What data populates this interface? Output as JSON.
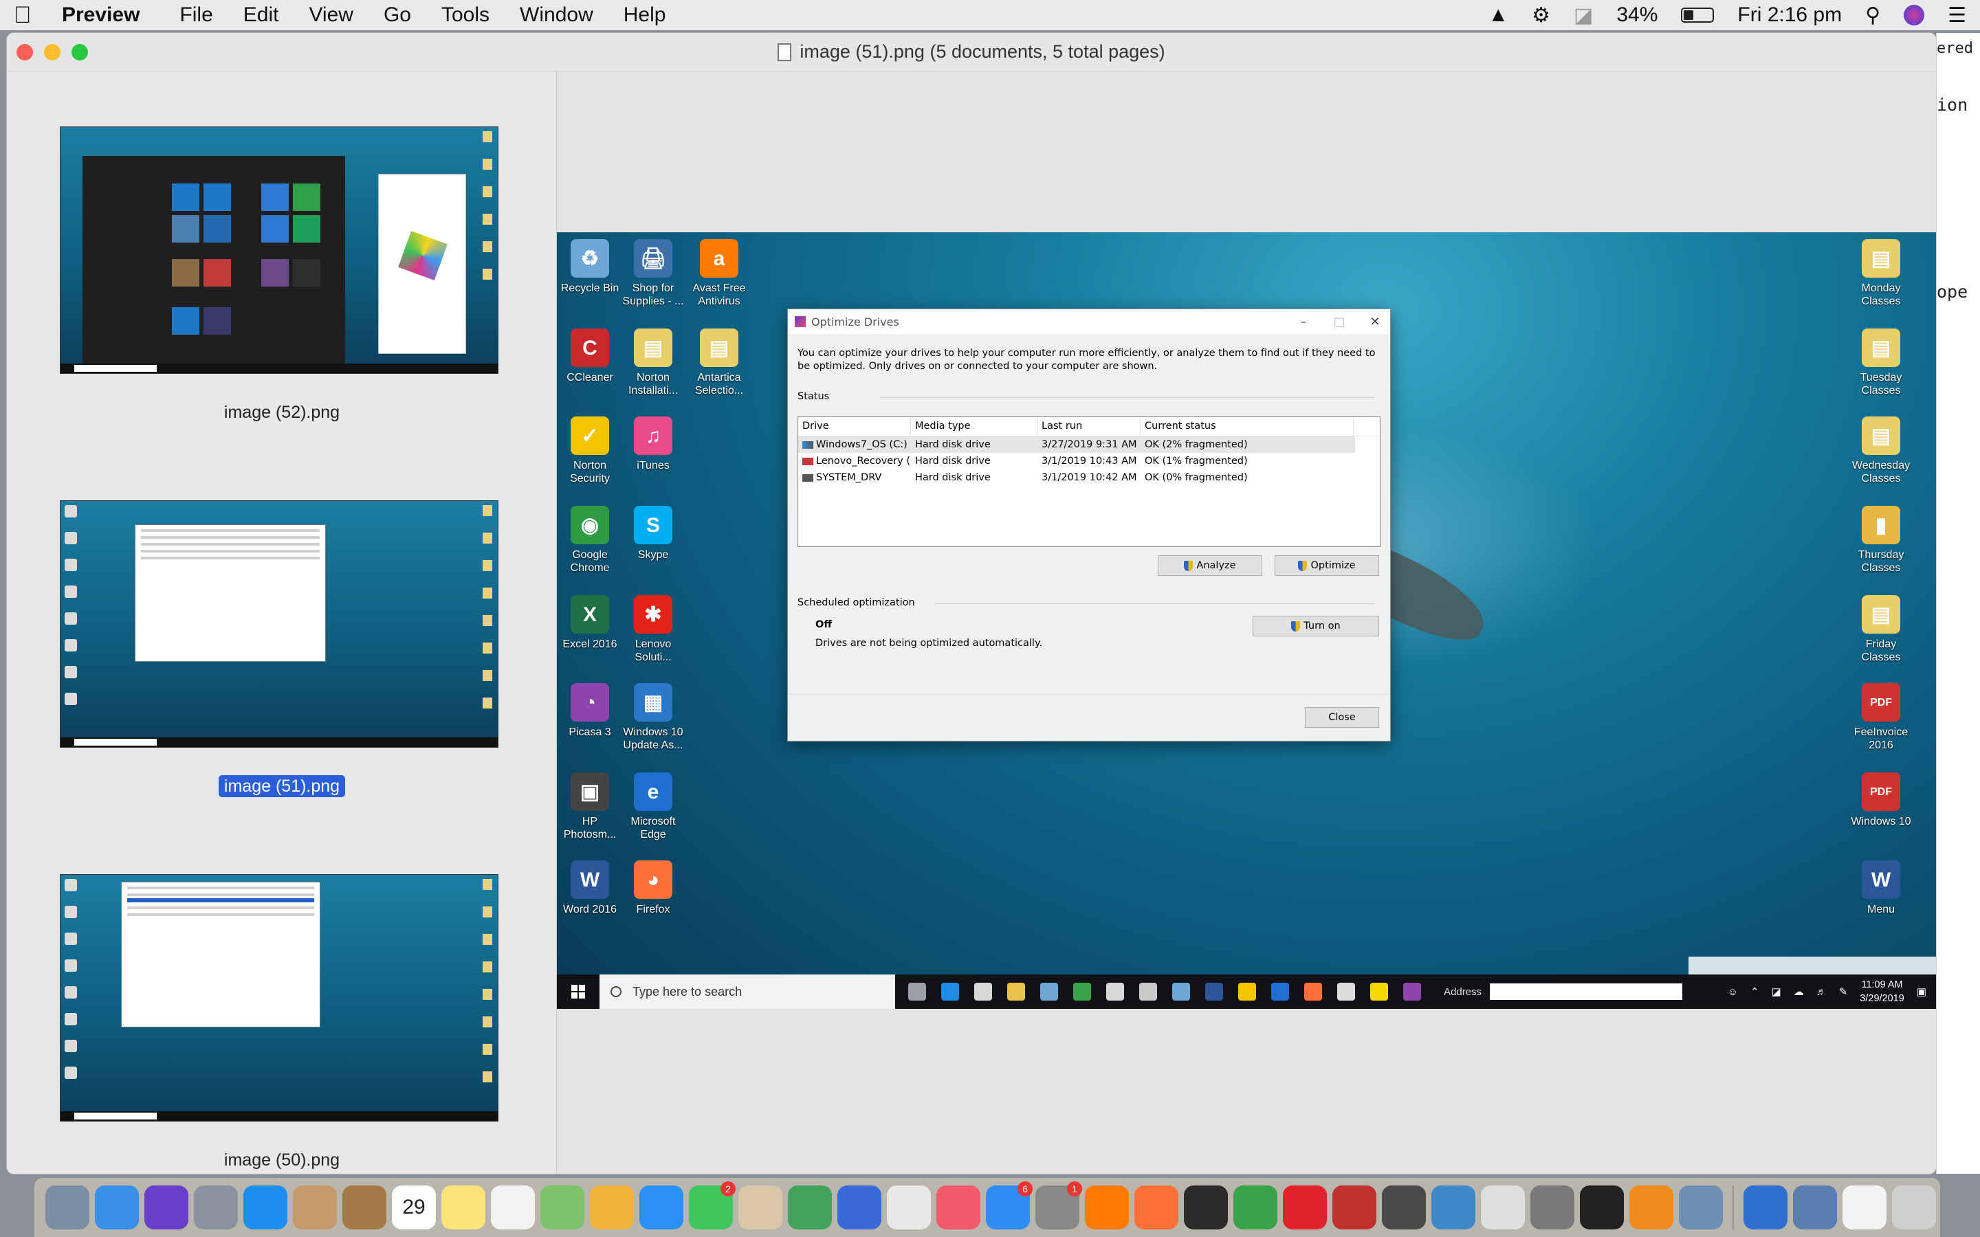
{
  "menubar": {
    "app": "Preview",
    "menus": [
      "File",
      "Edit",
      "View",
      "Go",
      "Tools",
      "Window",
      "Help"
    ],
    "battery": "34%",
    "battery_level": 0.34,
    "clock": "Fri 2:16 pm"
  },
  "window": {
    "title": "image (51).png (5 documents, 5 total pages)"
  },
  "sidebar": {
    "items": [
      {
        "label": "image (52).png",
        "selected": false
      },
      {
        "label": "image (51).png",
        "selected": true
      },
      {
        "label": "image (50).png",
        "selected": false
      }
    ]
  },
  "desktop": {
    "left_icons": [
      {
        "label": "Recycle Bin",
        "color": "#6fa6d8",
        "glyph": "♻"
      },
      {
        "label": "Shop for Supplies - ...",
        "color": "#3d6fa8",
        "glyph": "🖨"
      },
      {
        "label": "Avast Free Antivirus",
        "color": "#ff7a00",
        "glyph": "a"
      },
      {
        "label": "CCleaner",
        "color": "#c9282d",
        "glyph": "C"
      },
      {
        "label": "Norton Installati...",
        "color": "#e8cf6a",
        "glyph": "▤"
      },
      {
        "label": "Antartica Selectio...",
        "color": "#e8cf6a",
        "glyph": "▤"
      },
      {
        "label": "Norton Security",
        "color": "#f5c400",
        "glyph": "✓"
      },
      {
        "label": "iTunes",
        "color": "#ea4c89",
        "glyph": "♫"
      },
      {
        "label": "Google Chrome",
        "color": "#2f9a44",
        "glyph": "◉"
      },
      {
        "label": "Skype",
        "color": "#00aff0",
        "glyph": "S"
      },
      {
        "label": "Excel 2016",
        "color": "#1e7145",
        "glyph": "X"
      },
      {
        "label": "Lenovo Soluti...",
        "color": "#e2231a",
        "glyph": "✱"
      },
      {
        "label": "Picasa 3",
        "color": "#8e44ad",
        "glyph": "◔"
      },
      {
        "label": "Windows 10 Update As...",
        "color": "#2b78c8",
        "glyph": "▦"
      },
      {
        "label": "HP Photosm...",
        "color": "#444444",
        "glyph": "▣"
      },
      {
        "label": "Microsoft Edge",
        "color": "#1f6fd1",
        "glyph": "e"
      },
      {
        "label": "Word 2016",
        "color": "#2b579a",
        "glyph": "W"
      },
      {
        "label": "Firefox",
        "color": "#ff7139",
        "glyph": "◕"
      }
    ],
    "right_icons": [
      {
        "label": "Monday Classes",
        "color": "#e8cf6a",
        "glyph": "▤"
      },
      {
        "label": "Tuesday Classes",
        "color": "#e8cf6a",
        "glyph": "▤"
      },
      {
        "label": "Wednesday Classes",
        "color": "#e8cf6a",
        "glyph": "▤"
      },
      {
        "label": "Thursday Classes",
        "color": "#e8b844",
        "glyph": "▮"
      },
      {
        "label": "Friday Classes",
        "color": "#e8cf6a",
        "glyph": "▤"
      },
      {
        "label": "FeeInvoice 2016",
        "color": "#d0322d",
        "glyph": "PDF"
      },
      {
        "label": "Windows 10",
        "color": "#d0322d",
        "glyph": "PDF"
      },
      {
        "label": "Menu",
        "color": "#2b579a",
        "glyph": "W"
      }
    ]
  },
  "dialog": {
    "title": "Optimize Drives",
    "description": "You can optimize your drives to help your computer run more efficiently, or analyze them to find out if they need to be optimized. Only drives on or connected to your computer are shown.",
    "status_label": "Status",
    "columns": [
      "Drive",
      "Media type",
      "Last run",
      "Current status"
    ],
    "drives": [
      {
        "drive": "Windows7_OS (C:)",
        "media": "Hard disk drive",
        "last_run": "3/27/2019 9:31 AM",
        "status": "OK (2% fragmented)",
        "icon": "win"
      },
      {
        "drive": "Lenovo_Recovery (...",
        "media": "Hard disk drive",
        "last_run": "3/1/2019 10:43 AM",
        "status": "OK (1% fragmented)",
        "icon": "rec"
      },
      {
        "drive": "SYSTEM_DRV",
        "media": "Hard disk drive",
        "last_run": "3/1/2019 10:42 AM",
        "status": "OK (0% fragmented)",
        "icon": "sys"
      }
    ],
    "analyze_label": "Analyze",
    "optimize_label": "Optimize",
    "scheduled_label": "Scheduled optimization",
    "scheduled_state": "Off",
    "scheduled_desc": "Drives are not being optimized automatically.",
    "turn_on_label": "Turn on",
    "close_label": "Close"
  },
  "taskbar": {
    "search_placeholder": "Type here to search",
    "address_label": "Address",
    "time": "11:09 AM",
    "date": "3/29/2019",
    "apps": [
      "#9aa0a6",
      "#1f8ce6",
      "#d8d8d8",
      "#e8c24a",
      "#6fa6d8",
      "#3aa34a",
      "#d8d8d8",
      "#c9c9c9",
      "#6fa6d8",
      "#2b579a",
      "#f5c400",
      "#1f6fd1",
      "#ff7139",
      "#dddddd",
      "#f5d800",
      "#8e44ad"
    ]
  },
  "rightwin": {
    "texts": [
      "ered",
      "ion",
      "ope"
    ]
  },
  "dock": {
    "apps": [
      {
        "color": "#7c8ea5"
      },
      {
        "color": "#3a8fe8"
      },
      {
        "color": "#6a3fc8"
      },
      {
        "color": "#8b93a1"
      },
      {
        "color": "#1e8ef0"
      },
      {
        "color": "#c49a6c"
      },
      {
        "color": "#a57a45"
      },
      {
        "color": "#ffffff",
        "text": "29"
      },
      {
        "color": "#fbe27a"
      },
      {
        "color": "#f2f2f2"
      },
      {
        "color": "#7dc36a"
      },
      {
        "color": "#f2b33d"
      },
      {
        "color": "#2a8ff6"
      },
      {
        "color": "#3fc65c",
        "badge": "2"
      },
      {
        "color": "#d8c8a8"
      },
      {
        "color": "#41a35e"
      },
      {
        "color": "#3a6ad6"
      },
      {
        "color": "#e8e8e8"
      },
      {
        "color": "#f15c6c"
      },
      {
        "color": "#2f8cf6",
        "badge": "6"
      },
      {
        "color": "#888888",
        "badge": "1"
      },
      {
        "color": "#ff7a00"
      },
      {
        "color": "#ff7139"
      },
      {
        "color": "#2b2b2b"
      },
      {
        "color": "#3aa34a"
      },
      {
        "color": "#e0242a"
      },
      {
        "color": "#c0302c"
      },
      {
        "color": "#4a4a4a"
      },
      {
        "color": "#3f89c9"
      },
      {
        "color": "#dedede"
      },
      {
        "color": "#7a7a7a"
      },
      {
        "color": "#222222"
      },
      {
        "color": "#f28b1e"
      },
      {
        "color": "#6f8fb5"
      },
      {
        "color": "#2f6fd0"
      },
      {
        "color": "#5a7fb0"
      },
      {
        "color": "#f3f3f3"
      },
      {
        "color": "#cfcfcf"
      }
    ]
  }
}
